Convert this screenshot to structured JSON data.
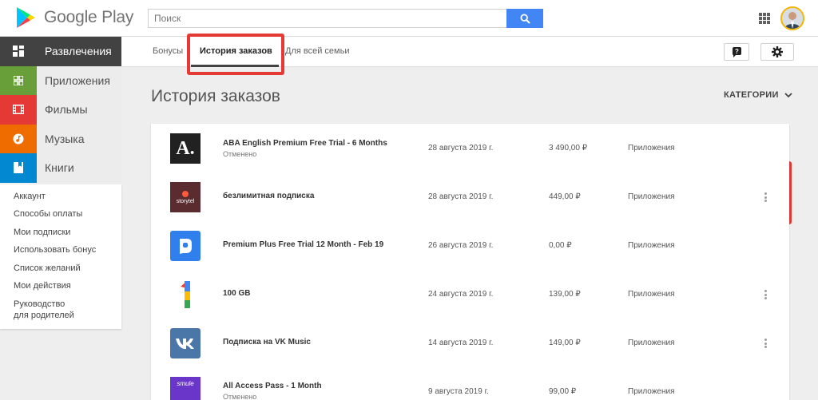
{
  "header": {
    "logo_text": "Google Play",
    "search_placeholder": "Поиск"
  },
  "sidebar": {
    "categories": [
      {
        "label": "Развлечения",
        "color": "#424242"
      },
      {
        "label": "Приложения",
        "color": "#689f38"
      },
      {
        "label": "Фильмы",
        "color": "#e53935"
      },
      {
        "label": "Музыка",
        "color": "#ef6c00"
      },
      {
        "label": "Книги",
        "color": "#0288d1"
      }
    ],
    "links": [
      {
        "label": "Аккаунт"
      },
      {
        "label": "Способы оплаты"
      },
      {
        "label": "Мои подписки"
      },
      {
        "label": "Использовать бонус"
      },
      {
        "label": "Список желаний"
      },
      {
        "label": "Мои действия"
      },
      {
        "label": "Руководство для родителей"
      }
    ]
  },
  "subnav": {
    "tabs": [
      {
        "label": "Бонусы"
      },
      {
        "label": "История заказов"
      },
      {
        "label": "Для всей семьи"
      }
    ]
  },
  "main": {
    "title": "История заказов",
    "categories_label": "КАТЕГОРИИ",
    "orders": [
      {
        "title": "ABA English Premium Free Trial - 6 Months",
        "sub": "Отменено",
        "date": "28 августа 2019 г.",
        "price": "3 490,00 ₽",
        "category": "Приложения",
        "icon": "aba-english-icon",
        "thumb_text": "A."
      },
      {
        "title": "безлимитная подписка",
        "sub": "",
        "date": "28 августа 2019 г.",
        "price": "449,00 ₽",
        "category": "Приложения",
        "icon": "storytel-icon",
        "thumb_text": "storytel"
      },
      {
        "title": "Premium Plus Free Trial 12 Month - Feb 19",
        "sub": "",
        "date": "26 августа 2019 г.",
        "price": "0,00 ₽",
        "category": "Приложения",
        "icon": "premium-plus-icon",
        "thumb_text": ""
      },
      {
        "title": "100 GB",
        "sub": "",
        "date": "24 августа 2019 г.",
        "price": "139,00 ₽",
        "category": "Приложения",
        "icon": "google-one-icon",
        "thumb_text": ""
      },
      {
        "title": "Подписка на VK Music",
        "sub": "",
        "date": "14 августа 2019 г.",
        "price": "149,00 ₽",
        "category": "Приложения",
        "icon": "vk-icon",
        "thumb_text": ""
      },
      {
        "title": "All Access Pass - 1 Month",
        "sub": "Отменено",
        "date": "9 августа 2019 г.",
        "price": "99,00 ₽",
        "category": "Приложения",
        "icon": "smule-icon",
        "thumb_text": "smule"
      }
    ]
  },
  "accent_color": "#4285f4",
  "highlight_color": "#e53935"
}
